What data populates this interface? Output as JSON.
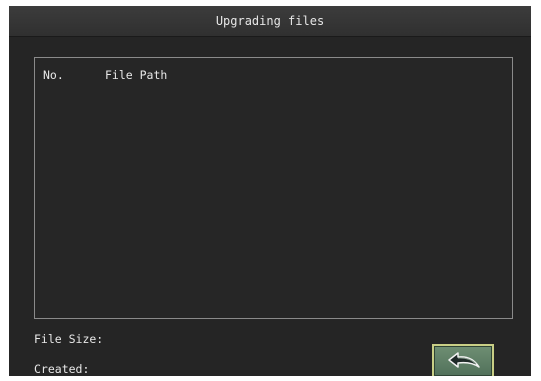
{
  "dialog": {
    "title": "Upgrading files"
  },
  "file_list": {
    "columns": [
      "No.",
      "File Path"
    ],
    "rows": []
  },
  "info": {
    "file_size_label": "File Size:",
    "created_label": "Created:"
  },
  "buttons": {
    "back_icon": "back-arrow-icon"
  },
  "colors": {
    "background": "#252525",
    "titlebar": "#333333",
    "text": "#e8e8e8",
    "list_border": "#8a8a8a",
    "button_fill": "#5f7f66",
    "button_border": "#c9cf86"
  }
}
